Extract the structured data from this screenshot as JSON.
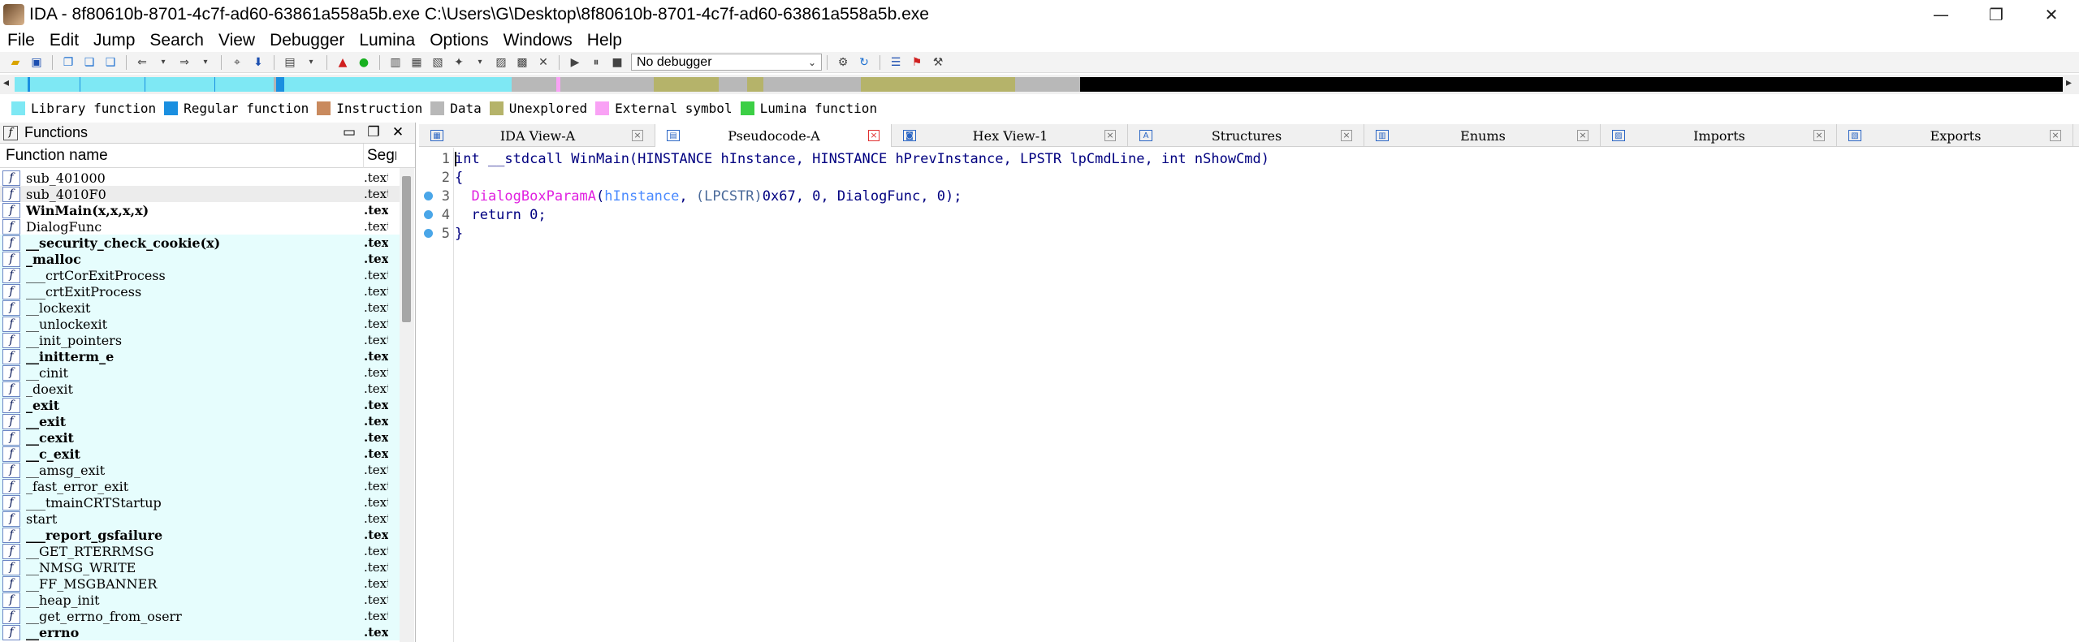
{
  "window": {
    "title": "IDA - 8f80610b-8701-4c7f-ad60-63861a558a5b.exe C:\\Users\\G\\Desktop\\8f80610b-8701-4c7f-ad60-63861a558a5b.exe",
    "minimize": "—",
    "maximize": "❐",
    "close": "✕"
  },
  "menu": [
    "File",
    "Edit",
    "Jump",
    "Search",
    "View",
    "Debugger",
    "Lumina",
    "Options",
    "Windows",
    "Help"
  ],
  "toolbar": {
    "debugger_select": "No debugger"
  },
  "legend": [
    {
      "label": "Library function",
      "color": "#7ee8f4"
    },
    {
      "label": "Regular function",
      "color": "#1a8fe0"
    },
    {
      "label": "Instruction",
      "color": "#c98a5e"
    },
    {
      "label": "Data",
      "color": "#b8b8b8"
    },
    {
      "label": "Unexplored",
      "color": "#b5b36a"
    },
    {
      "label": "External symbol",
      "color": "#f9a2f5"
    },
    {
      "label": "Lumina function",
      "color": "#3ccf45"
    }
  ],
  "functions_panel": {
    "title": "Functions",
    "col_name": "Function name",
    "col_segment": "Segment",
    "rows": [
      {
        "name": "sub_401000",
        "seg": ".text",
        "bold": false,
        "lib": false,
        "sel": false
      },
      {
        "name": "sub_4010F0",
        "seg": ".text",
        "bold": false,
        "lib": false,
        "sel": true
      },
      {
        "name": "WinMain(x,x,x,x)",
        "seg": ".text",
        "bold": true,
        "lib": false,
        "sel": false
      },
      {
        "name": "DialogFunc",
        "seg": ".text",
        "bold": false,
        "lib": false,
        "sel": false
      },
      {
        "name": "__security_check_cookie(x)",
        "seg": ".text",
        "bold": true,
        "lib": true,
        "sel": false
      },
      {
        "name": "_malloc",
        "seg": ".text",
        "bold": true,
        "lib": true,
        "sel": false
      },
      {
        "name": "___crtCorExitProcess",
        "seg": ".text",
        "bold": false,
        "lib": true,
        "sel": false
      },
      {
        "name": "___crtExitProcess",
        "seg": ".text",
        "bold": false,
        "lib": true,
        "sel": false
      },
      {
        "name": "__lockexit",
        "seg": ".text",
        "bold": false,
        "lib": true,
        "sel": false
      },
      {
        "name": "__unlockexit",
        "seg": ".text",
        "bold": false,
        "lib": true,
        "sel": false
      },
      {
        "name": "__init_pointers",
        "seg": ".text",
        "bold": false,
        "lib": true,
        "sel": false
      },
      {
        "name": "__initterm_e",
        "seg": ".text",
        "bold": true,
        "lib": true,
        "sel": false
      },
      {
        "name": "__cinit",
        "seg": ".text",
        "bold": false,
        "lib": true,
        "sel": false
      },
      {
        "name": "_doexit",
        "seg": ".text",
        "bold": false,
        "lib": true,
        "sel": false
      },
      {
        "name": "_exit",
        "seg": ".text",
        "bold": true,
        "lib": true,
        "sel": false
      },
      {
        "name": "__exit",
        "seg": ".text",
        "bold": true,
        "lib": true,
        "sel": false
      },
      {
        "name": "__cexit",
        "seg": ".text",
        "bold": true,
        "lib": true,
        "sel": false
      },
      {
        "name": "__c_exit",
        "seg": ".text",
        "bold": true,
        "lib": true,
        "sel": false
      },
      {
        "name": "__amsg_exit",
        "seg": ".text",
        "bold": false,
        "lib": true,
        "sel": false
      },
      {
        "name": "_fast_error_exit",
        "seg": ".text",
        "bold": false,
        "lib": true,
        "sel": false
      },
      {
        "name": "___tmainCRTStartup",
        "seg": ".text",
        "bold": false,
        "lib": true,
        "sel": false
      },
      {
        "name": "start",
        "seg": ".text",
        "bold": false,
        "lib": true,
        "sel": false
      },
      {
        "name": "___report_gsfailure",
        "seg": ".text",
        "bold": true,
        "lib": true,
        "sel": false
      },
      {
        "name": "__GET_RTERRMSG",
        "seg": ".text",
        "bold": false,
        "lib": true,
        "sel": false
      },
      {
        "name": "__NMSG_WRITE",
        "seg": ".text",
        "bold": false,
        "lib": true,
        "sel": false
      },
      {
        "name": "__FF_MSGBANNER",
        "seg": ".text",
        "bold": false,
        "lib": true,
        "sel": false
      },
      {
        "name": "__heap_init",
        "seg": ".text",
        "bold": false,
        "lib": true,
        "sel": false
      },
      {
        "name": "__get_errno_from_oserr",
        "seg": ".text",
        "bold": false,
        "lib": true,
        "sel": false
      },
      {
        "name": "__errno",
        "seg": ".text",
        "bold": true,
        "lib": true,
        "sel": false
      }
    ]
  },
  "tabs": [
    {
      "label": "IDA View-A",
      "active": false
    },
    {
      "label": "Pseudocode-A",
      "active": true
    },
    {
      "label": "Hex View-1",
      "active": false
    },
    {
      "label": "Structures",
      "active": false
    },
    {
      "label": "Enums",
      "active": false
    },
    {
      "label": "Imports",
      "active": false
    },
    {
      "label": "Exports",
      "active": false
    }
  ],
  "code": [
    {
      "ln": "1",
      "bp": false,
      "parts": [
        [
          "t",
          "int __stdcall WinMain(HINSTANCE hInstance, HINSTANCE hPrevInstance, LPSTR lpCmdLine, int nShowCmd)"
        ]
      ]
    },
    {
      "ln": "2",
      "bp": false,
      "parts": [
        [
          "t",
          "{"
        ]
      ]
    },
    {
      "ln": "3",
      "bp": true,
      "parts": [
        [
          "t",
          "  "
        ],
        [
          "fn",
          "DialogBoxParamA"
        ],
        [
          "t",
          "("
        ],
        [
          "param",
          "hInstance"
        ],
        [
          "t",
          ", "
        ],
        [
          "cast",
          "(LPCSTR)"
        ],
        [
          "t",
          "0x67, 0, "
        ],
        [
          "fn2",
          "DialogFunc"
        ],
        [
          "t",
          ", 0);"
        ]
      ]
    },
    {
      "ln": "4",
      "bp": true,
      "parts": [
        [
          "t",
          "  return 0;"
        ]
      ]
    },
    {
      "ln": "5",
      "bp": true,
      "parts": [
        [
          "t",
          "}"
        ]
      ]
    }
  ]
}
